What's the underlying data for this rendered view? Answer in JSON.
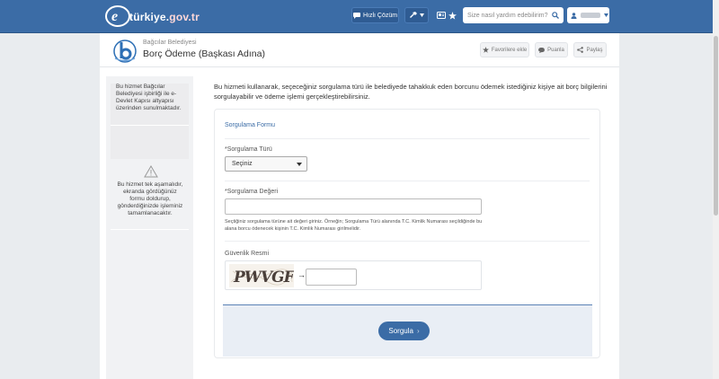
{
  "topbar": {
    "logo_prefix": "türkiye.",
    "logo_suffix": "gov.tr",
    "quick_solution_label": "Hızlı Çözüm",
    "search_placeholder": "Size nasıl yardım edebilirim?",
    "colors": {
      "bar": "#3b6ca6",
      "button": "#2f5c93"
    }
  },
  "header": {
    "institution": "Bağcılar Belediyesi",
    "service_title": "Borç Ödeme (Başkası Adına)",
    "favorite_label": "Favorilere ekle",
    "rate_label": "Puanla",
    "share_label": "Paylaş"
  },
  "sidebar": {
    "info_text": "Bu hizmet Bağcılar Belediyesi işbirliği ile e-Devlet Kapısı altyapısı üzerinden sunulmaktadır.",
    "warning_text": "Bu hizmet tek aşamalıdır, ekranda gördüğünüz formu doldurup, gönderdiğinizde işleminiz tamamlanacaktır."
  },
  "main": {
    "intro": "Bu hizmeti kullanarak, seçeceğiniz sorgulama türü ile belediyede tahakkuk eden borcunu ödemek istediğiniz kişiye ait borç bilgilerini sorgulayabilir ve ödeme işlemi gerçekleştirebilirsiniz.",
    "form_title": "Sorgulama Formu",
    "query_type_label": "*Sorgulama Türü",
    "query_type_value": "Seçiniz",
    "query_value_label": "*Sorgulama Değeri",
    "query_value_input": "",
    "help_text": "Seçtiğiniz sorgulama türüne ait değeri giriniz. Örneğin; Sorgulama Türü alanında T.C. Kimlik Numarası seçildiğinde bu alana borcu ödenecek kişinin T.C. Kimlik Numarası girilmelidir.",
    "captcha_label": "Güvenlik Resmi",
    "captcha_text": "PWVGF",
    "captcha_arrow": "→",
    "captcha_input": "",
    "submit_label": "Sorgula",
    "submit_chevron": "›"
  }
}
